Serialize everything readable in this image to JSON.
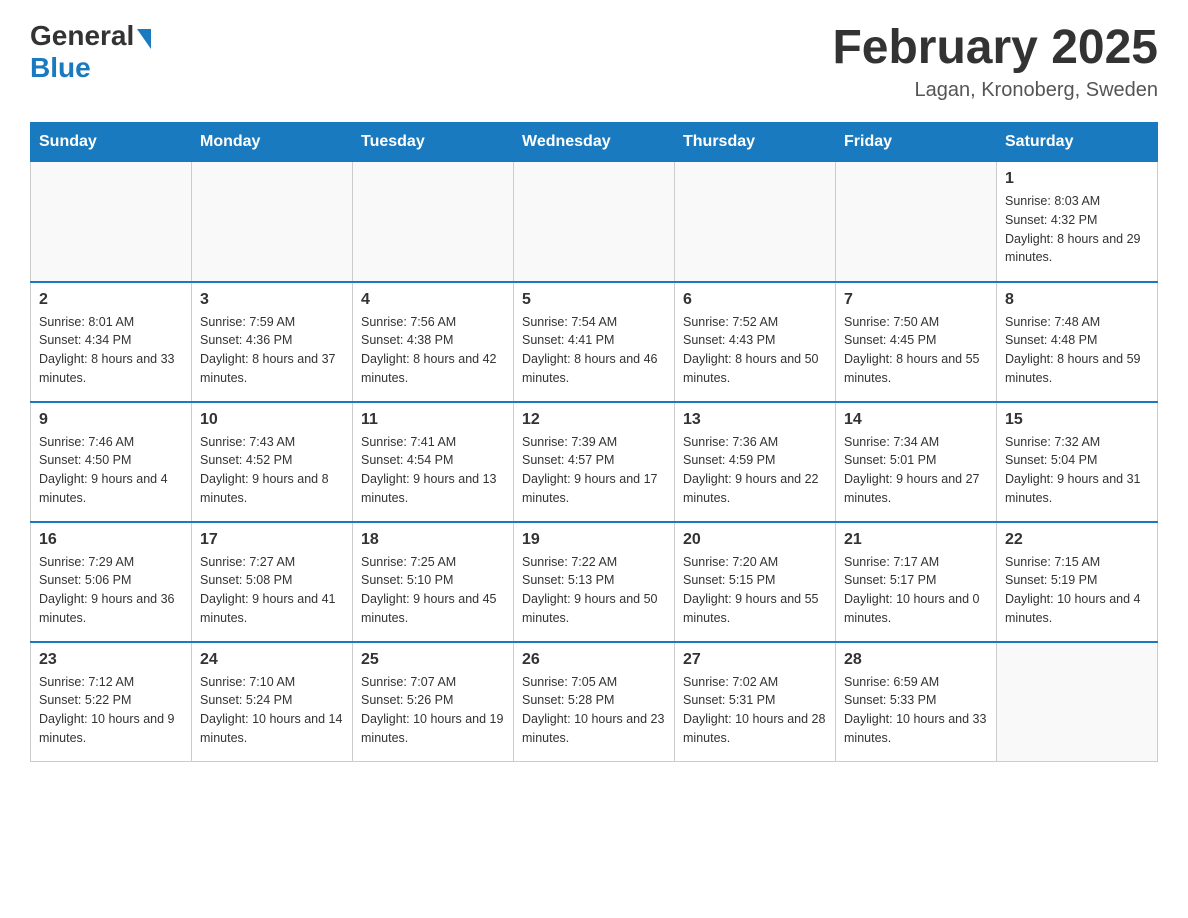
{
  "header": {
    "logo_general": "General",
    "logo_blue": "Blue",
    "month_title": "February 2025",
    "location": "Lagan, Kronoberg, Sweden"
  },
  "weekdays": [
    "Sunday",
    "Monday",
    "Tuesday",
    "Wednesday",
    "Thursday",
    "Friday",
    "Saturday"
  ],
  "weeks": [
    [
      {
        "day": "",
        "info": ""
      },
      {
        "day": "",
        "info": ""
      },
      {
        "day": "",
        "info": ""
      },
      {
        "day": "",
        "info": ""
      },
      {
        "day": "",
        "info": ""
      },
      {
        "day": "",
        "info": ""
      },
      {
        "day": "1",
        "info": "Sunrise: 8:03 AM\nSunset: 4:32 PM\nDaylight: 8 hours and 29 minutes."
      }
    ],
    [
      {
        "day": "2",
        "info": "Sunrise: 8:01 AM\nSunset: 4:34 PM\nDaylight: 8 hours and 33 minutes."
      },
      {
        "day": "3",
        "info": "Sunrise: 7:59 AM\nSunset: 4:36 PM\nDaylight: 8 hours and 37 minutes."
      },
      {
        "day": "4",
        "info": "Sunrise: 7:56 AM\nSunset: 4:38 PM\nDaylight: 8 hours and 42 minutes."
      },
      {
        "day": "5",
        "info": "Sunrise: 7:54 AM\nSunset: 4:41 PM\nDaylight: 8 hours and 46 minutes."
      },
      {
        "day": "6",
        "info": "Sunrise: 7:52 AM\nSunset: 4:43 PM\nDaylight: 8 hours and 50 minutes."
      },
      {
        "day": "7",
        "info": "Sunrise: 7:50 AM\nSunset: 4:45 PM\nDaylight: 8 hours and 55 minutes."
      },
      {
        "day": "8",
        "info": "Sunrise: 7:48 AM\nSunset: 4:48 PM\nDaylight: 8 hours and 59 minutes."
      }
    ],
    [
      {
        "day": "9",
        "info": "Sunrise: 7:46 AM\nSunset: 4:50 PM\nDaylight: 9 hours and 4 minutes."
      },
      {
        "day": "10",
        "info": "Sunrise: 7:43 AM\nSunset: 4:52 PM\nDaylight: 9 hours and 8 minutes."
      },
      {
        "day": "11",
        "info": "Sunrise: 7:41 AM\nSunset: 4:54 PM\nDaylight: 9 hours and 13 minutes."
      },
      {
        "day": "12",
        "info": "Sunrise: 7:39 AM\nSunset: 4:57 PM\nDaylight: 9 hours and 17 minutes."
      },
      {
        "day": "13",
        "info": "Sunrise: 7:36 AM\nSunset: 4:59 PM\nDaylight: 9 hours and 22 minutes."
      },
      {
        "day": "14",
        "info": "Sunrise: 7:34 AM\nSunset: 5:01 PM\nDaylight: 9 hours and 27 minutes."
      },
      {
        "day": "15",
        "info": "Sunrise: 7:32 AM\nSunset: 5:04 PM\nDaylight: 9 hours and 31 minutes."
      }
    ],
    [
      {
        "day": "16",
        "info": "Sunrise: 7:29 AM\nSunset: 5:06 PM\nDaylight: 9 hours and 36 minutes."
      },
      {
        "day": "17",
        "info": "Sunrise: 7:27 AM\nSunset: 5:08 PM\nDaylight: 9 hours and 41 minutes."
      },
      {
        "day": "18",
        "info": "Sunrise: 7:25 AM\nSunset: 5:10 PM\nDaylight: 9 hours and 45 minutes."
      },
      {
        "day": "19",
        "info": "Sunrise: 7:22 AM\nSunset: 5:13 PM\nDaylight: 9 hours and 50 minutes."
      },
      {
        "day": "20",
        "info": "Sunrise: 7:20 AM\nSunset: 5:15 PM\nDaylight: 9 hours and 55 minutes."
      },
      {
        "day": "21",
        "info": "Sunrise: 7:17 AM\nSunset: 5:17 PM\nDaylight: 10 hours and 0 minutes."
      },
      {
        "day": "22",
        "info": "Sunrise: 7:15 AM\nSunset: 5:19 PM\nDaylight: 10 hours and 4 minutes."
      }
    ],
    [
      {
        "day": "23",
        "info": "Sunrise: 7:12 AM\nSunset: 5:22 PM\nDaylight: 10 hours and 9 minutes."
      },
      {
        "day": "24",
        "info": "Sunrise: 7:10 AM\nSunset: 5:24 PM\nDaylight: 10 hours and 14 minutes."
      },
      {
        "day": "25",
        "info": "Sunrise: 7:07 AM\nSunset: 5:26 PM\nDaylight: 10 hours and 19 minutes."
      },
      {
        "day": "26",
        "info": "Sunrise: 7:05 AM\nSunset: 5:28 PM\nDaylight: 10 hours and 23 minutes."
      },
      {
        "day": "27",
        "info": "Sunrise: 7:02 AM\nSunset: 5:31 PM\nDaylight: 10 hours and 28 minutes."
      },
      {
        "day": "28",
        "info": "Sunrise: 6:59 AM\nSunset: 5:33 PM\nDaylight: 10 hours and 33 minutes."
      },
      {
        "day": "",
        "info": ""
      }
    ]
  ]
}
